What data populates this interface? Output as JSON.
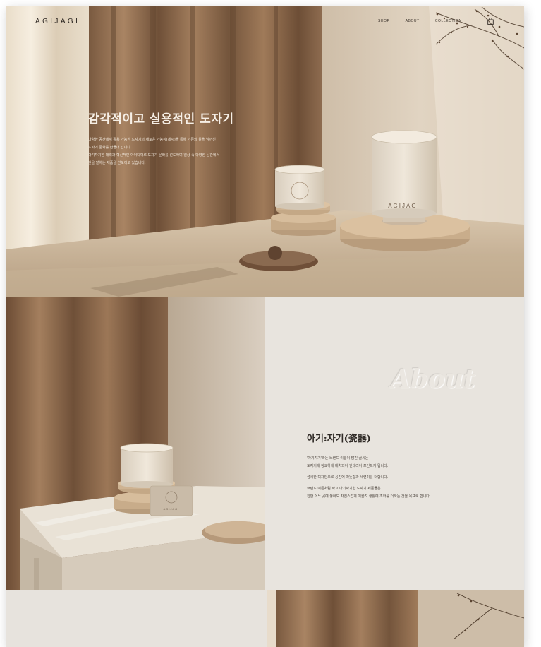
{
  "brand": {
    "logo": "AGIJAGI"
  },
  "nav": {
    "items": [
      {
        "label": "SHOP"
      },
      {
        "label": "ABOUT"
      },
      {
        "label": "COLLECTION"
      }
    ],
    "cart_icon": "shopping-bag-icon"
  },
  "hero": {
    "title": "감각적이고 실용적인 도자기",
    "lines": [
      "다양한 공간에서 활용 가능한 도자기의 새로운 가능성(제시)을 통해 기존의 틀을 넘어선",
      "도자기 문화를 만들어 갑니다.",
      "아기자기한 매력과 혁신적인 아이디어로 도자기 문화를 선도하며 일상 속 다양한 공간에서",
      "빛을 발하는 제품을 선보이고 있습니다."
    ],
    "cup_stamp": "AGIJAGI"
  },
  "about": {
    "watermark": "About",
    "heading": "아기:자기(瓷器)",
    "paragraphs": [
      [
        "'아기자기'라는 브랜드 이름이 담긴 글씨는",
        "도자기에 정교하게 배치되어 인테리어 포인트가 됩니다."
      ],
      [
        "섬세한 디자인으로 공간에 따뜻함과 세련미를 더합니다."
      ],
      [
        "브랜드 이름처럼 작고 아기자기한 도자기 제품들은",
        "집안 어느 곳에 놓아도 자연스럽게 어울려 생활에 조화를 더하는 것을 목표로 합니다."
      ]
    ],
    "card_text": "AGIJAGI"
  }
}
